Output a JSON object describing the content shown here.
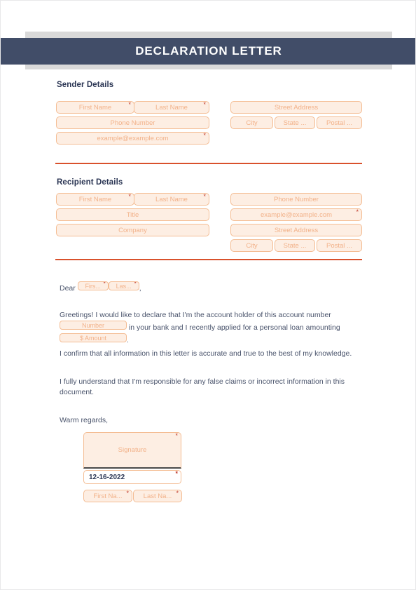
{
  "document": {
    "title": "DECLARATION LETTER"
  },
  "sections": {
    "sender": {
      "heading": "Sender Details",
      "fields": {
        "first_name": "First Name",
        "last_name": "Last Name",
        "phone": "Phone Number",
        "email": "example@example.com",
        "street_address": "Street Address",
        "city": "City",
        "state": "State ...",
        "postal": "Postal ..."
      }
    },
    "recipient": {
      "heading": "Recipient Details",
      "fields": {
        "first_name": "First Name",
        "last_name": "Last Name",
        "title": "Title",
        "company": "Company",
        "phone": "Phone Number",
        "email": "example@example.com",
        "street_address": "Street Address",
        "city": "City",
        "state": "State ...",
        "postal": "Postal ..."
      }
    }
  },
  "letter": {
    "salutation_prefix": "Dear ",
    "salutation_first_name": "Firs...",
    "salutation_last_name": "Las...",
    "salutation_suffix": ",",
    "paragraph1_part1": "Greetings! I would like to declare that I'm the account holder of this account number ",
    "paragraph1_field_number": "Number",
    "paragraph1_part2": " in your bank and I recently applied for a personal loan amounting ",
    "paragraph1_field_amount": "$ Amount",
    "paragraph1_part3": ".",
    "paragraph2": "I confirm that all information in this letter is accurate and true to the best of my knowledge.",
    "paragraph3": "I fully understand that I'm responsible for any false claims or incorrect information in this document.",
    "closing": "Warm regards,"
  },
  "signature_block": {
    "signature_placeholder": "Signature",
    "date_value": "12-16-2022",
    "first_name": "First Na...",
    "last_name": "Last Na..."
  },
  "colors": {
    "banner_navy": "#414d68",
    "banner_gray": "#d9d9d9",
    "divider_orange": "#d9512c",
    "field_fill": "#fdeee3",
    "field_border": "#f4bd94",
    "field_text": "#f2b28a",
    "heading_navy": "#2b3654",
    "body_text": "#49536b",
    "required_asterisk": "#c0392b"
  }
}
